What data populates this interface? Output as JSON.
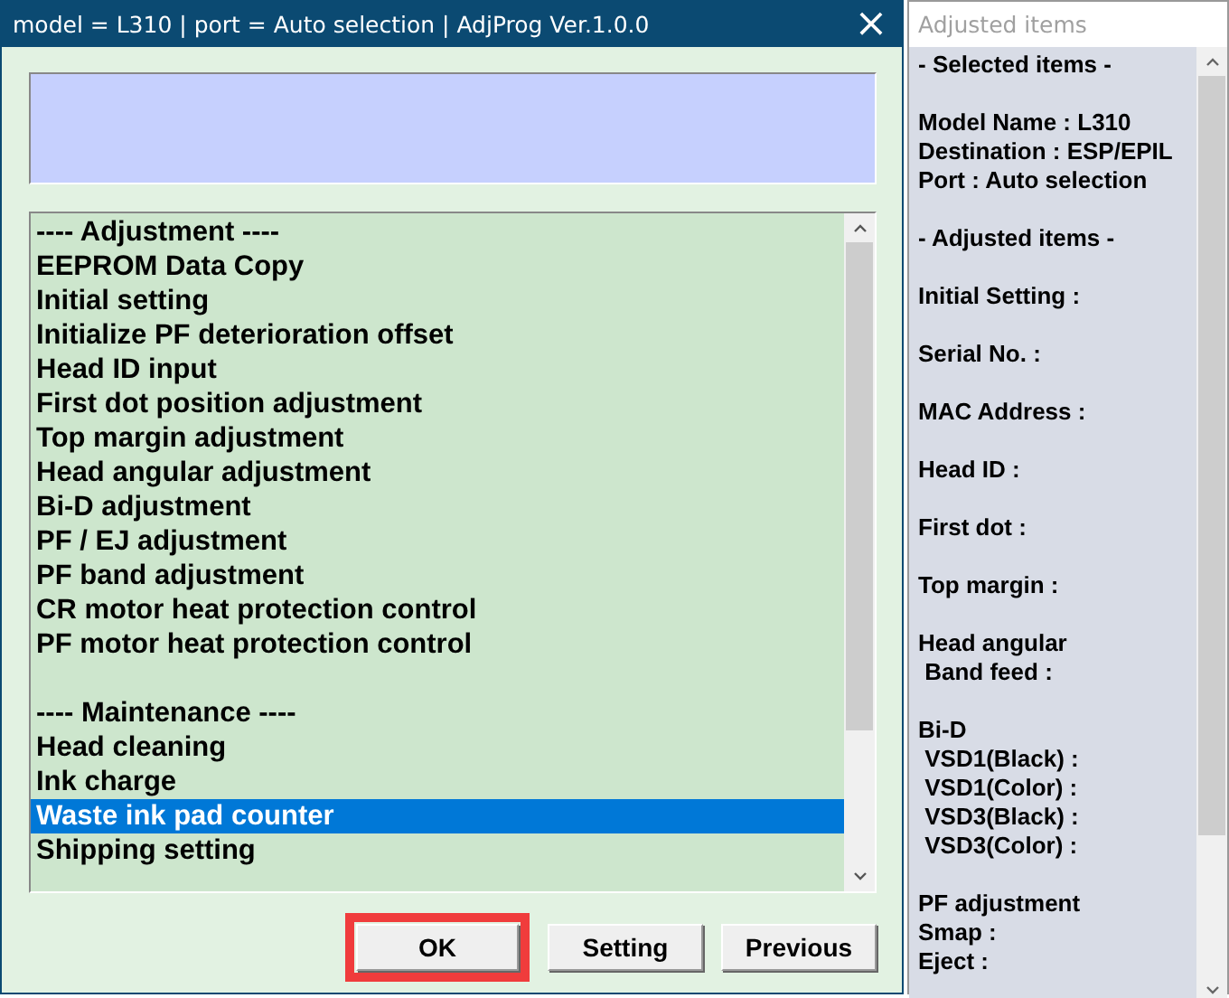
{
  "window": {
    "title": "model = L310 | port = Auto selection | AdjProg Ver.1.0.0",
    "close": "×"
  },
  "list_sections": [
    {
      "items": [
        {
          "label": "---- Adjustment ----",
          "selected": false
        },
        {
          "label": "EEPROM Data Copy",
          "selected": false
        },
        {
          "label": "Initial setting",
          "selected": false
        },
        {
          "label": "Initialize PF deterioration offset",
          "selected": false
        },
        {
          "label": "Head ID input",
          "selected": false
        },
        {
          "label": "First dot position adjustment",
          "selected": false
        },
        {
          "label": "Top margin adjustment",
          "selected": false
        },
        {
          "label": "Head angular adjustment",
          "selected": false
        },
        {
          "label": "Bi-D adjustment",
          "selected": false
        },
        {
          "label": "PF / EJ adjustment",
          "selected": false
        },
        {
          "label": "PF band adjustment",
          "selected": false
        },
        {
          "label": "CR motor heat protection control",
          "selected": false
        },
        {
          "label": "PF motor heat protection control",
          "selected": false
        }
      ]
    },
    {
      "items": [
        {
          "label": "---- Maintenance ----",
          "selected": false
        },
        {
          "label": "Head cleaning",
          "selected": false
        },
        {
          "label": "Ink charge",
          "selected": false
        },
        {
          "label": "Waste ink pad counter",
          "selected": true
        },
        {
          "label": "Shipping setting",
          "selected": false
        }
      ]
    }
  ],
  "buttons": [
    {
      "label": "OK",
      "highlighted": true
    },
    {
      "label": "Setting",
      "highlighted": false
    },
    {
      "label": "Previous",
      "highlighted": false
    }
  ],
  "side_panel": {
    "title": "Adjusted items",
    "groups": [
      [
        "- Selected items -"
      ],
      [
        "Model Name : L310",
        "Destination : ESP/EPIL",
        "Port : Auto selection"
      ],
      [
        "- Adjusted items -"
      ],
      [
        "Initial Setting :"
      ],
      [
        "Serial No. :"
      ],
      [
        "MAC Address :"
      ],
      [
        "Head ID :"
      ],
      [
        "First dot :"
      ],
      [
        "Top margin :"
      ],
      [
        "Head angular",
        " Band feed :"
      ],
      [
        "Bi-D",
        " VSD1(Black) :",
        " VSD1(Color) :",
        " VSD3(Black) :",
        " VSD3(Color) :"
      ],
      [
        "PF adjustment",
        "Smap :",
        "Eject :"
      ]
    ]
  }
}
